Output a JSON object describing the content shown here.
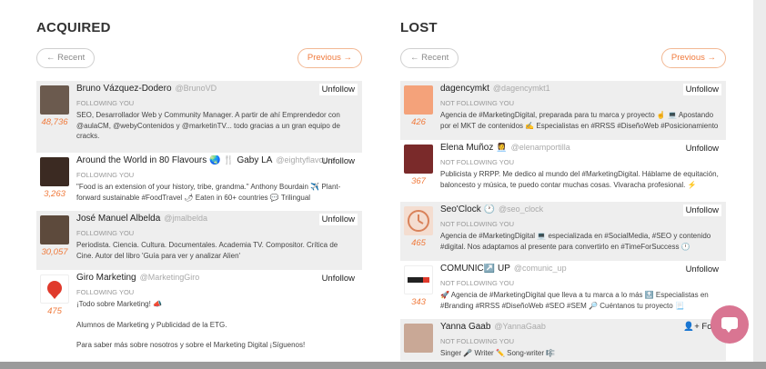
{
  "acquired": {
    "title": "ACQUIRED",
    "recent_label": "← Recent",
    "previous_label": "Previous →",
    "items": [
      {
        "name": "Bruno Vázquez-Dodero",
        "handle": "@BrunoVD",
        "count": "48,736",
        "action": "Unfollow",
        "status": "FOLLOWING YOU",
        "bio": "SEO, Desarrollador Web y Community Manager. A partir de ahí Emprendedor con @aulaCM, @webyContenidos y @marketinTV... todo gracias a un gran equipo de cracks.",
        "avatar_color": "#6b5a4e"
      },
      {
        "name": "Around the World in 80 Flavours 🌏 🍴 Gaby LA",
        "handle": "@eightyflavours",
        "count": "3,263",
        "action": "Unfollow",
        "status": "FOLLOWING YOU",
        "bio": "\"Food is an extension of your history, tribe, grandma.\" Anthony Bourdain ✈️ Plant-forward sustainable #FoodTravel 🌶 Eaten in 60+ countries 💬 Trilingual",
        "avatar_color": "#3b2a22"
      },
      {
        "name": "José Manuel Albelda",
        "handle": "@jmalbelda",
        "count": "30,057",
        "action": "Unfollow",
        "status": "FOLLOWING YOU",
        "bio": "Periodista. Ciencia. Cultura. Documentales. Academia TV. Compositor. Crítica de Cine. Autor del libro 'Guía para ver y analizar Alien'",
        "avatar_color": "#5d4a3c"
      },
      {
        "name": "Giro Marketing",
        "handle": "@MarketingGiro",
        "count": "475",
        "action": "Unfollow",
        "status": "FOLLOWING YOU",
        "bio": "¡Todo sobre Marketing! 📣",
        "extra1": "Alumnos de Marketing y Publicidad de la ETG.",
        "extra2": "Para saber más sobre nosotros y sobre el Marketing Digital ¡Síguenos!",
        "avatar_color": "#e03a2c"
      }
    ]
  },
  "lost": {
    "title": "LOST",
    "recent_label": "← Recent",
    "previous_label": "Previous →",
    "items": [
      {
        "name": "dagencymkt",
        "handle": "@dagencymkt1",
        "count": "426",
        "action": "Unfollow",
        "status": "NOT FOLLOWING YOU",
        "bio": "Agencia de #MarketingDigital, preparada para tu marca y proyecto ☝️ 💻 Apostando por el MKT de contenidos ✍️ Especialistas en #RRSS #DiseñoWeb #Posicionamiento",
        "avatar_color": "#f4a27a"
      },
      {
        "name": "Elena Muñoz 👩‍💼",
        "handle": "@elenamportilla",
        "count": "367",
        "action": "Unfollow",
        "status": "NOT FOLLOWING YOU",
        "bio": "Publicista y RRPP. Me dedico al mundo del #MarketingDigital. Háblame de equitación, baloncesto y música, te puedo contar muchas cosas. Vivaracha profesional. ⚡",
        "avatar_color": "#7a2a2a"
      },
      {
        "name": "Seo'Clock 🕐",
        "handle": "@seo_clock",
        "count": "465",
        "action": "Unfollow",
        "status": "NOT FOLLOWING YOU",
        "bio": "Agencia de #MarketingDigital 💻 especializada en #SocialMedia, #SEO y contenido #digital. Nos adaptamos al presente para convertirlo en #TimeForSuccess 🕛",
        "avatar_color": "#f4ddd0"
      },
      {
        "name": "COMUNIC↗️ UP",
        "handle": "@comunic_up",
        "count": "343",
        "action": "Unfollow",
        "status": "NOT FOLLOWING YOU",
        "bio": "🚀 Agencia de #MarketingDigital que lleva a tu marca a lo más 🔝 Especialistas en #Branding #RRSS #DiseñoWeb #SEO #SEM 🔎 Cuéntanos tu proyecto 📃",
        "avatar_color": "#ffffff"
      },
      {
        "name": "Yanna Gaab",
        "handle": "@YannaGaab",
        "count": "",
        "action": "Follo",
        "status": "NOT FOLLOWING YOU",
        "bio": "Singer 🎤 Writer ✏️ Song-writer 🎼",
        "avatar_color": "#c9a896"
      }
    ]
  },
  "chat": {
    "icon": "chat-bubble-icon"
  }
}
